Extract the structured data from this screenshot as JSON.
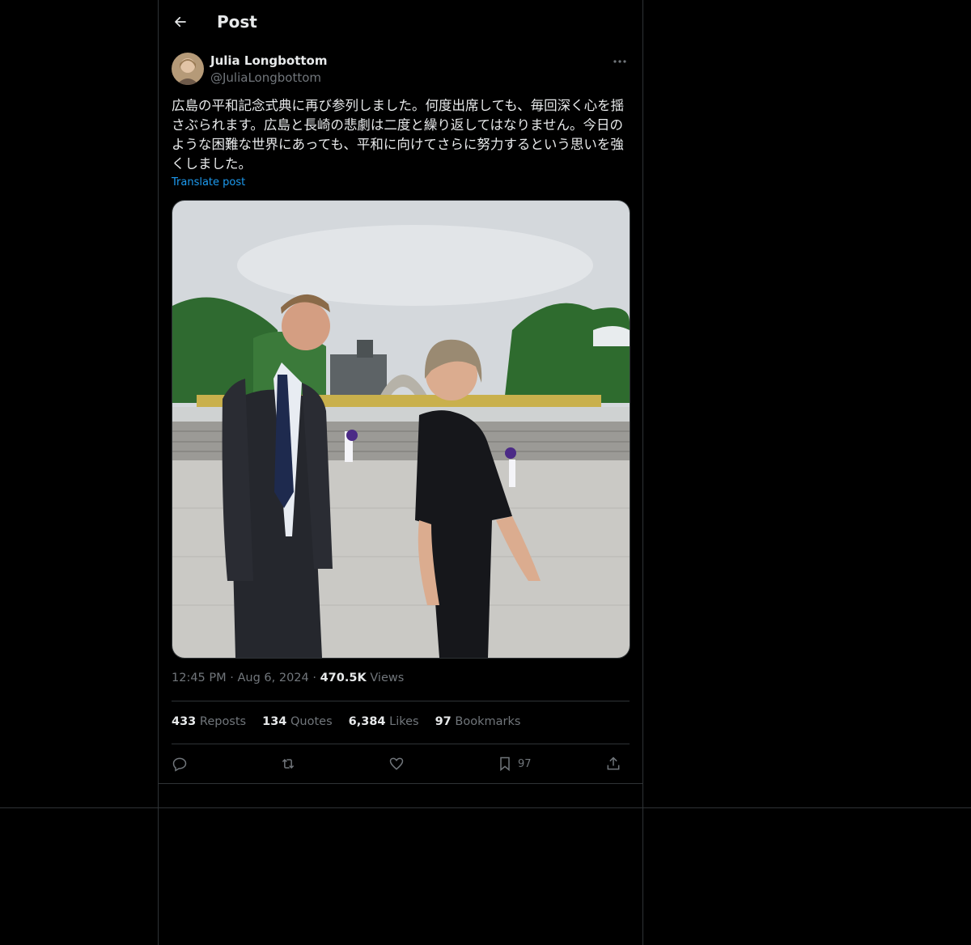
{
  "header": {
    "title": "Post"
  },
  "author": {
    "name": "Julia Longbottom",
    "handle": "@JuliaLongbottom"
  },
  "tweet": {
    "text": "広島の平和記念式典に再び参列しました。何度出席しても、毎回深く心を揺さぶられます。広島と長崎の悲劇は二度と繰り返してはなりません。今日のような困難な世界にあっても、平和に向けてさらに努力するという思いを強くしました。",
    "translate_label": "Translate post"
  },
  "meta": {
    "time": "12:45 PM",
    "date": "Aug 6, 2024",
    "views_count": "470.5K",
    "views_label": "Views"
  },
  "stats": {
    "reposts_count": "433",
    "reposts_label": "Reposts",
    "quotes_count": "134",
    "quotes_label": "Quotes",
    "likes_count": "6,384",
    "likes_label": "Likes",
    "bookmarks_count": "97",
    "bookmarks_label": "Bookmarks"
  },
  "actions": {
    "bookmark_count": "97"
  },
  "colors": {
    "background": "#000000",
    "border": "#2f3336",
    "text": "#e7e9ea",
    "muted": "#71767b",
    "link": "#1d9bf0"
  }
}
